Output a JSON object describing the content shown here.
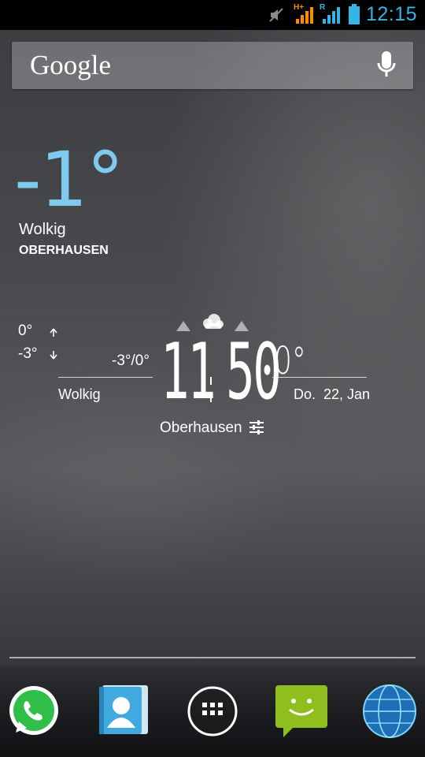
{
  "status_bar": {
    "time": "12:15",
    "net1": "H+",
    "net2": "R",
    "accent": "#33b5e5"
  },
  "search": {
    "logo": "Google",
    "icon": "mic-icon"
  },
  "weather_large": {
    "temperature": "-1°",
    "condition": "Wolkig",
    "city": "OBERHAUSEN",
    "accent": "#7fcbef"
  },
  "clock_widget": {
    "high": "0°",
    "low": "-3°",
    "range": "-3°/0°",
    "condition": "Wolkig",
    "time_hours": "11",
    "time_minutes": "50",
    "current_temp": "0°",
    "date": "Do.  22, Jan",
    "city": "Oberhausen",
    "weather_icon": "cloudy-icon",
    "settings_icon": "sliders-icon"
  },
  "dock": {
    "apps": [
      "whatsapp-icon",
      "contacts-icon",
      "app-drawer-icon",
      "messaging-icon",
      "browser-globe-icon"
    ]
  }
}
